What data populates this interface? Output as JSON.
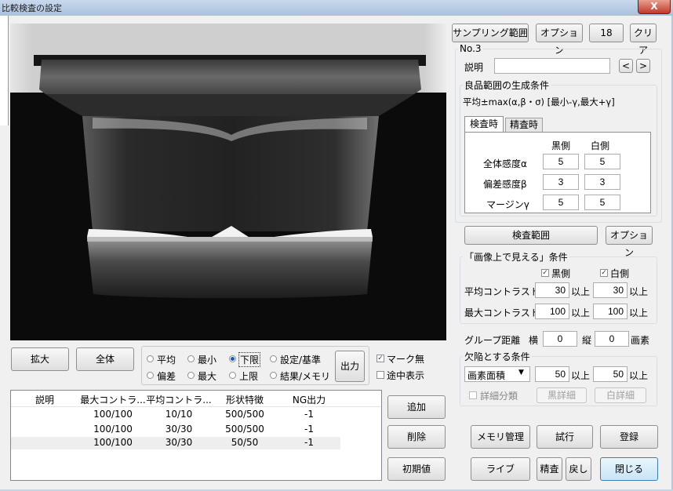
{
  "window": {
    "title": "比較検査の設定",
    "close_label": "X"
  },
  "top_buttons": {
    "sampling_range": "サンプリング範囲",
    "option": "オプション",
    "number": "18",
    "clear": "クリア"
  },
  "item": {
    "number": "No.3",
    "description_label": "説明",
    "description_value": "",
    "prev": "<",
    "next": ">"
  },
  "range_group": {
    "title": "良品範囲の生成条件",
    "formula": "平均±max(α,β・σ) [最小-γ,最大+γ]",
    "tabs": [
      "検査時",
      "精査時"
    ],
    "col_black": "黒側",
    "col_white": "白側",
    "rows": [
      {
        "label": "全体感度α",
        "black": "5",
        "white": "5"
      },
      {
        "label": "偏差感度β",
        "black": "3",
        "white": "3"
      },
      {
        "label": "マージンγ",
        "black": "5",
        "white": "5"
      }
    ]
  },
  "inspect_range": {
    "button": "検査範囲",
    "option": "オプション"
  },
  "visible_group": {
    "title": "「画像上で見える」条件",
    "black_label": "黒側",
    "white_label": "白側",
    "black_checked": true,
    "white_checked": true,
    "avg_label": "平均コントラスト",
    "avg_black": "30",
    "avg_white": "30",
    "max_label": "最大コントラスト",
    "max_black": "100",
    "max_white": "100",
    "above": "以上"
  },
  "group_distance": {
    "label": "グループ距離",
    "h_label": "横",
    "h_value": "0",
    "v_label": "縦",
    "v_value": "0",
    "unit": "画素"
  },
  "defect_group": {
    "title": "欠陥とする条件",
    "select_value": "画素面積",
    "value1": "50",
    "value2": "50",
    "above": "以上",
    "detail_class": "詳細分類",
    "black_detail": "黒詳細",
    "white_detail": "白詳細"
  },
  "view_buttons": {
    "zoom": "拡大",
    "all": "全体"
  },
  "radios": {
    "avg": "平均",
    "min": "最小",
    "lower": "下限",
    "setting": "設定/基準",
    "dev": "偏差",
    "max": "最大",
    "upper": "上限",
    "result": "結果/メモリ",
    "selected": "下限"
  },
  "output_button": "出力",
  "checks": {
    "no_mark": "マーク無",
    "midway": "途中表示",
    "no_mark_checked": true,
    "midway_checked": false
  },
  "table": {
    "columns": [
      "説明",
      "最大コントラ...",
      "平均コントラ...",
      "形状特徴",
      "NG出力"
    ],
    "rows": [
      [
        "",
        "100/100",
        "10/10",
        "500/500",
        "-1"
      ],
      [
        "",
        "100/100",
        "30/30",
        "500/500",
        "-1"
      ],
      [
        "",
        "100/100",
        "30/30",
        "50/50",
        "-1"
      ]
    ]
  },
  "list_buttons": {
    "add": "追加",
    "delete": "削除",
    "init": "初期値"
  },
  "bottom_buttons": {
    "memory": "メモリ管理",
    "trial": "試行",
    "register": "登録",
    "live": "ライブ",
    "review": "精査",
    "back": "戻し",
    "close": "閉じる"
  }
}
